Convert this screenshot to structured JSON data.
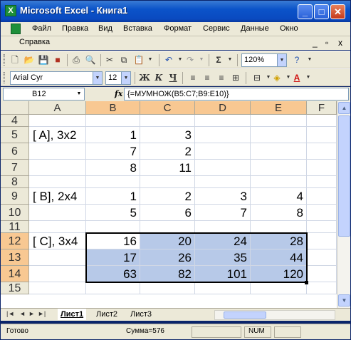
{
  "window": {
    "title": "Microsoft Excel - Книга1",
    "app_icon": "X",
    "minimize_glyph": "_",
    "maximize_glyph": "□",
    "close_glyph": "✕"
  },
  "menu": {
    "items": [
      "Файл",
      "Правка",
      "Вид",
      "Вставка",
      "Формат",
      "Сервис",
      "Данные",
      "Окно"
    ],
    "help": "Справка",
    "doc_controls": [
      "_",
      "▫",
      "x"
    ]
  },
  "toolbar_standard": {
    "icons": [
      "new-icon",
      "open-icon",
      "save-icon",
      "permission-icon",
      "print-icon",
      "print-preview-icon",
      "cut-icon",
      "copy-icon",
      "paste-icon",
      "undo-icon",
      "redo-icon",
      "autosum-icon",
      "sort-icon"
    ],
    "zoom": "120%"
  },
  "toolbar_format": {
    "font": "Arial Cyr",
    "size": "12",
    "bold": "Ж",
    "italic": "К",
    "underline": "Ч",
    "font_color_letter": "А"
  },
  "formula_bar": {
    "name_box": "B12",
    "fx": "fx",
    "formula": "{=МУМНОЖ(B5:C7;B9:E10)}"
  },
  "grid": {
    "columns": [
      "A",
      "B",
      "C",
      "D",
      "E",
      "F"
    ],
    "rows": [
      {
        "num": "4",
        "cells": [
          "",
          "",
          "",
          "",
          ""
        ]
      },
      {
        "num": "5",
        "cells": [
          "[ A], 3x2",
          "1",
          "3",
          "",
          ""
        ]
      },
      {
        "num": "6",
        "cells": [
          "",
          "7",
          "2",
          "",
          ""
        ]
      },
      {
        "num": "7",
        "cells": [
          "",
          "8",
          "11",
          "",
          ""
        ]
      },
      {
        "num": "8",
        "cells": [
          "",
          "",
          "",
          "",
          ""
        ]
      },
      {
        "num": "9",
        "cells": [
          "[ B], 2x4",
          "1",
          "2",
          "3",
          "4"
        ]
      },
      {
        "num": "10",
        "cells": [
          "",
          "5",
          "6",
          "7",
          "8"
        ]
      },
      {
        "num": "11",
        "cells": [
          "",
          "",
          "",
          "",
          ""
        ]
      },
      {
        "num": "12",
        "cells": [
          "[ C], 3x4",
          "16",
          "20",
          "24",
          "28"
        ]
      },
      {
        "num": "13",
        "cells": [
          "",
          "17",
          "26",
          "35",
          "44"
        ]
      },
      {
        "num": "14",
        "cells": [
          "",
          "63",
          "82",
          "101",
          "120"
        ]
      },
      {
        "num": "15",
        "cells": [
          "",
          "",
          "",
          "",
          ""
        ]
      }
    ]
  },
  "sheets": {
    "tabs": [
      "Лист1",
      "Лист2",
      "Лист3"
    ],
    "active": "Лист1"
  },
  "status": {
    "ready": "Готово",
    "sum": "Сумма=576",
    "num": "NUM"
  }
}
